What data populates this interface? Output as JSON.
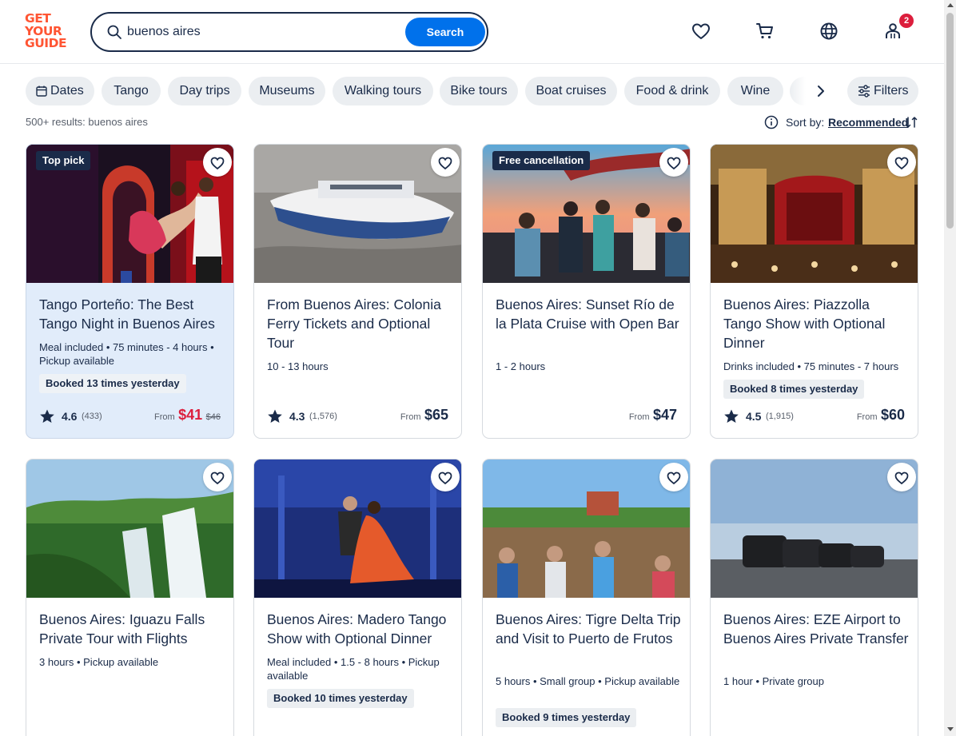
{
  "header": {
    "logo_lines": [
      "GET",
      "YOUR",
      "GUIDE"
    ],
    "search_value": "buenos aires",
    "search_button": "Search",
    "cart_badge": "2",
    "icons": [
      "heart-icon",
      "cart-icon",
      "globe-icon",
      "user-icon"
    ]
  },
  "chips": {
    "items": [
      "Dates",
      "Tango",
      "Day trips",
      "Museums",
      "Walking tours",
      "Bike tours",
      "Boat cruises",
      "Food & drink",
      "Wine"
    ],
    "filters_label": "Filters"
  },
  "results": {
    "count_text": "500+ results: buenos aires",
    "sort_label": "Sort by:",
    "sort_value": "Recommended"
  },
  "cards": [
    {
      "tag": "Top pick",
      "title": "Tango Porteño: The Best Tango Night in Buenos Aires",
      "meta": "Meal included • 75 minutes - 4 hours • Pickup available",
      "booked": "Booked 13 times yesterday",
      "rating": "4.6",
      "reviews": "(433)",
      "from": "From",
      "price": "$41",
      "old_price": "$46"
    },
    {
      "title": "From Buenos Aires: Colonia Ferry Tickets and Optional Tour",
      "meta": "10 - 13 hours",
      "rating": "4.3",
      "reviews": "(1,576)",
      "from": "From",
      "price": "$65"
    },
    {
      "tag": "Free cancellation",
      "title": "Buenos Aires: Sunset Río de la Plata Cruise with Open Bar",
      "meta": "1 - 2 hours",
      "from": "From",
      "price": "$47"
    },
    {
      "title": "Buenos Aires: Piazzolla Tango Show with Optional Dinner",
      "meta": "Drinks included • 75 minutes - 7 hours",
      "booked": "Booked 8 times yesterday",
      "rating": "4.5",
      "reviews": "(1,915)",
      "from": "From",
      "price": "$60"
    },
    {
      "title": "Buenos Aires: Iguazu Falls Private Tour with Flights",
      "meta": "3 hours • Pickup available"
    },
    {
      "title": "Buenos Aires: Madero Tango Show with Optional Dinner",
      "meta": "Meal included • 1.5 - 8 hours • Pickup available",
      "booked": "Booked 10 times yesterday"
    },
    {
      "title": "Buenos Aires: Tigre Delta Trip and Visit to Puerto de Frutos",
      "meta": "5 hours • Small group • Pickup available",
      "booked": "Booked 9 times yesterday"
    },
    {
      "title": "Buenos Aires: EZE Airport to Buenos Aires Private Transfer",
      "meta": "1 hour • Private group"
    }
  ],
  "colors": {
    "brand": "#ff5533",
    "primary": "#0071eb",
    "text": "#1a2b49",
    "sale": "#dc1e3c",
    "highlight_card": "#e1ecfa"
  }
}
